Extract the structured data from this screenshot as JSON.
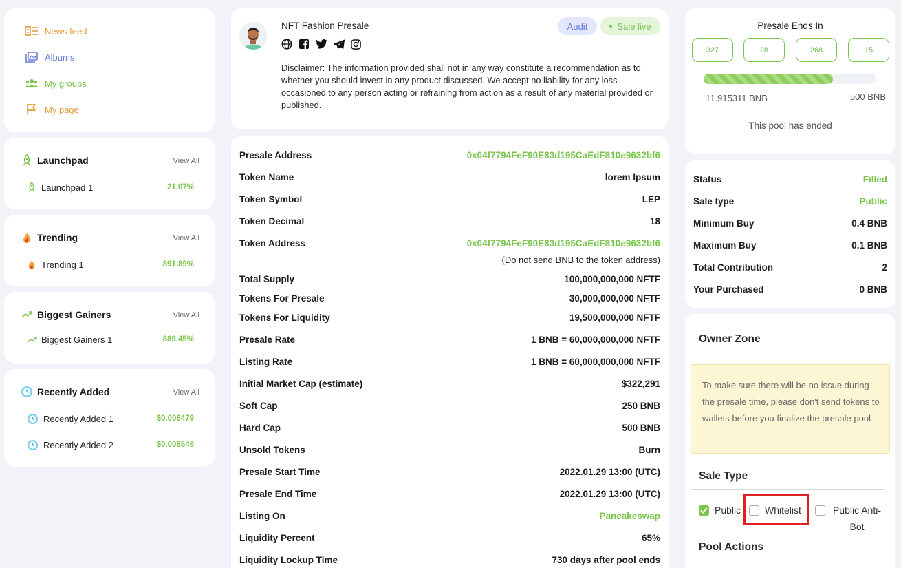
{
  "colors": {
    "accent": "#7bc54d",
    "nav_orange": "#e59c3a",
    "nav_blue": "#6a7fdc",
    "nav_green": "#7bc54d"
  },
  "nav": {
    "items": [
      {
        "label": "News feed",
        "icon": "news-feed-icon"
      },
      {
        "label": "Albums",
        "icon": "albums-icon"
      },
      {
        "label": "My groups",
        "icon": "groups-icon"
      },
      {
        "label": "My page",
        "icon": "flag-icon"
      }
    ]
  },
  "launchpad": {
    "title": "Launchpad",
    "view_all": "View All",
    "items": [
      {
        "label": "Launchpad 1",
        "value": "21.07%"
      }
    ]
  },
  "trending": {
    "title": "Trending",
    "view_all": "View All",
    "items": [
      {
        "label": "Trending 1",
        "value": "891.89%"
      }
    ]
  },
  "gainers": {
    "title": "Biggest Gainers",
    "view_all": "View All",
    "items": [
      {
        "label": "Biggest Gainers 1",
        "value": "889.45%"
      }
    ]
  },
  "recent": {
    "title": "Recently Added",
    "view_all": "View All",
    "items": [
      {
        "label": "Recently Added 1",
        "value": "$0.006479"
      },
      {
        "label": "Recently Added 2",
        "value": "$0.008546"
      }
    ]
  },
  "project": {
    "name": "NFT Fashion Presale",
    "badge_audit": "Audit",
    "badge_live": "Sale live",
    "social_icons": [
      "globe-icon",
      "facebook-icon",
      "twitter-icon",
      "telegram-icon",
      "instagram-icon"
    ],
    "disclaimer": "Disclaimer: The information provided shall not in any way constitute a recommendation as to whether you should invest in any product discussed. We accept no liability for any loss occasioned to any person acting or refraining from action as a result of any material provided or published."
  },
  "details": {
    "rows": [
      {
        "label": "Presale Address",
        "value": "0x04f7794FeF90E83d195CaEdF810e9632bf6",
        "green": true
      },
      {
        "label": "Token Name",
        "value": "lorem Ipsum"
      },
      {
        "label": "Token Symbol",
        "value": "LEP"
      },
      {
        "label": "Token Decimal",
        "value": "18"
      },
      {
        "label": "Token Address",
        "value": "0x04f7794FeF90E83d195CaEdF810e9632bf6",
        "green": true
      },
      {
        "label": "Total Supply",
        "value": "100,000,000,000 NFTF"
      },
      {
        "label": "Tokens For Presale",
        "value": "30,000,000,000 NFTF"
      },
      {
        "label": "Tokens For Liquidity",
        "value": "19,500,000,000 NFTF"
      },
      {
        "label": "Presale Rate",
        "value": "1 BNB = 60,000,000,000 NFTF"
      },
      {
        "label": "Listing Rate",
        "value": "1 BNB = 60,000,000,000 NFTF"
      },
      {
        "label": "Initial Market Cap (estimate)",
        "value": "$322,291"
      },
      {
        "label": "Soft Cap",
        "value": "250 BNB"
      },
      {
        "label": "Hard Cap",
        "value": "500 BNB"
      },
      {
        "label": "Unsold Tokens",
        "value": "Burn"
      },
      {
        "label": "Presale Start Time",
        "value": "2022.01.29 13:00 (UTC)"
      },
      {
        "label": "Presale End Time",
        "value": "2022.01.29 13:00 (UTC)"
      },
      {
        "label": "Listing On",
        "value": "Pancakeswap",
        "green": true
      },
      {
        "label": "Liquidity Percent",
        "value": "65%"
      },
      {
        "label": "Liquidity Lockup Time",
        "value": "730 days after pool ends"
      }
    ],
    "token_address_note": "(Do not send BNB to the token address)"
  },
  "countdown": {
    "title": "Presale Ends In",
    "values": [
      "327",
      "28",
      "268",
      "15"
    ],
    "raised": "11.915311 BNB",
    "cap": "500 BNB",
    "progress_fraction": 0.75,
    "status_text": "This pool has ended"
  },
  "stats": {
    "rows": [
      {
        "label": "Status",
        "value": "Filled",
        "green": true
      },
      {
        "label": "Sale type",
        "value": "Public",
        "green": true
      },
      {
        "label": "Minimum Buy",
        "value": "0.4 BNB"
      },
      {
        "label": "Maximum Buy",
        "value": "0.1 BNB"
      },
      {
        "label": "Total Contribution",
        "value": "2"
      },
      {
        "label": "Your Purchased",
        "value": "0 BNB"
      }
    ]
  },
  "owner_zone": {
    "title": "Owner Zone",
    "notice": "To make sure there will be no issue during the presale time, please don't send tokens to wallets before you finalize the presale pool.",
    "sale_type_title": "Sale Type",
    "options": [
      {
        "label": "Public",
        "checked": true
      },
      {
        "label": "Whitelist",
        "checked": false
      },
      {
        "label": "Public Anti-Bot",
        "checked": false
      }
    ],
    "pool_actions_title": "Pool Actions"
  }
}
